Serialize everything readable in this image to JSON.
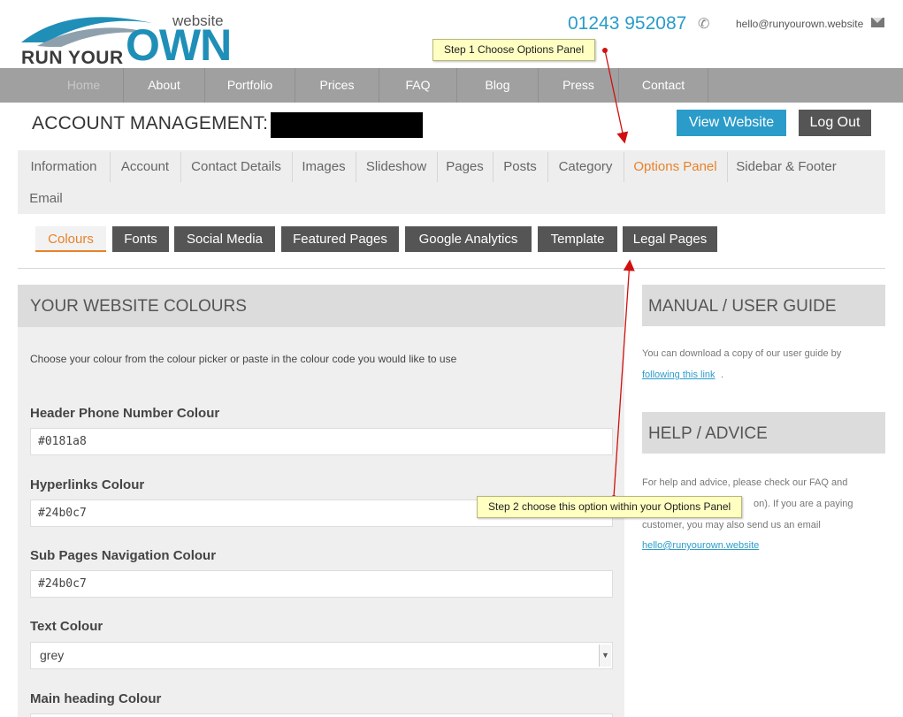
{
  "header": {
    "logo_text_run": "RUN YOUR",
    "logo_text_own": "OWN",
    "logo_text_website": "website",
    "phone": "01243 952087",
    "email": "hello@runyourown.website"
  },
  "nav": {
    "items": [
      "Home",
      "About",
      "Portfolio",
      "Prices",
      "FAQ",
      "Blog",
      "Press",
      "Contact"
    ]
  },
  "account": {
    "title": "ACCOUNT MANAGEMENT:",
    "view_website": "View Website",
    "log_out": "Log Out"
  },
  "tabs": [
    "Information",
    "Account",
    "Contact Details",
    "Images",
    "Slideshow",
    "Pages",
    "Posts",
    "Category",
    "Options Panel",
    "Sidebar & Footer",
    "Email"
  ],
  "active_tab": "Options Panel",
  "subtabs": [
    "Colours",
    "Fonts",
    "Social Media",
    "Featured Pages",
    "Google Analytics",
    "Template",
    "Legal Pages"
  ],
  "active_subtab": "Colours",
  "colours_panel": {
    "title": "YOUR WEBSITE COLOURS",
    "description": "Choose your colour from the colour picker or paste in the colour code you would like to use",
    "fields": [
      {
        "label": "Header Phone Number Colour",
        "value": "#0181a8"
      },
      {
        "label": "Hyperlinks Colour",
        "value": "#24b0c7"
      },
      {
        "label": "Sub Pages Navigation Colour",
        "value": "#24b0c7"
      },
      {
        "label": "Text Colour",
        "value": "grey"
      },
      {
        "label": "Main heading Colour",
        "value": ""
      }
    ]
  },
  "sidebar": {
    "manual_title": "MANUAL / USER GUIDE",
    "manual_text": "You can download a copy of our user guide by",
    "manual_link": "following this link",
    "manual_link_suffix": ".",
    "help_title": "HELP / ADVICE",
    "help_line1": "For help and advice, please check our FAQ and",
    "help_line2": "on). If you are a paying",
    "help_line3": "customer, you may also send us an email",
    "help_email": "hello@runyourown.website"
  },
  "callouts": {
    "step1": "Step 1 Choose Options Panel",
    "step2": "Step 2 choose this option within your Options Panel"
  },
  "colors": {
    "accent_blue": "#2b9cc9",
    "active_orange": "#e8822a",
    "nav_gray": "#a0a0a0",
    "dark_button": "#555555",
    "arrow_red": "#d01010"
  }
}
